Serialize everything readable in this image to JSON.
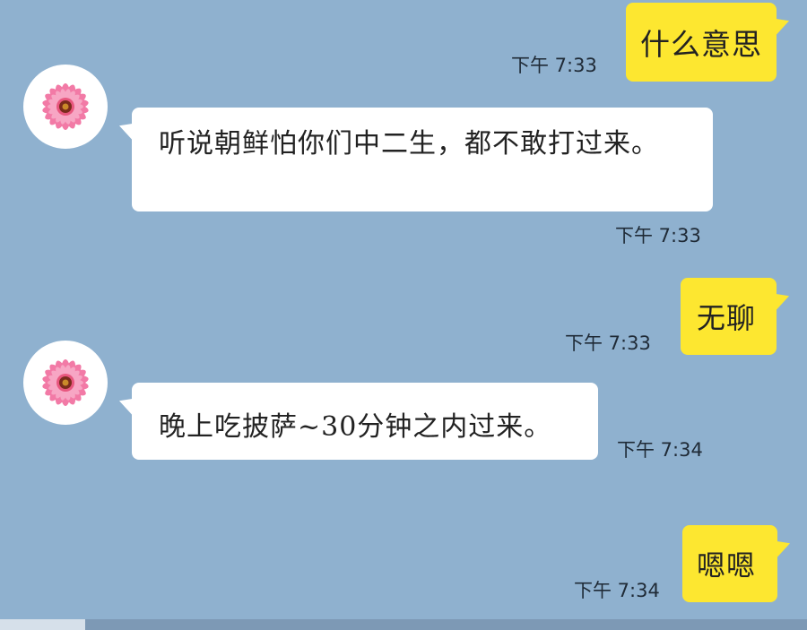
{
  "messages": [
    {
      "side": "outgoing",
      "text": "什么意思",
      "time": "下午 7:33"
    },
    {
      "side": "incoming",
      "text": "听说朝鲜怕你们中二生，都不敢打过来。",
      "time": "下午 7:33"
    },
    {
      "side": "outgoing",
      "text": "无聊",
      "time": "下午 7:33"
    },
    {
      "side": "incoming",
      "text": "晚上吃披萨~30分钟之内过来。",
      "time": "下午 7:34"
    },
    {
      "side": "outgoing",
      "text": "嗯嗯",
      "time": "下午 7:34"
    }
  ],
  "colors": {
    "background": "#8fb1cf",
    "outgoing_bubble": "#fde730",
    "incoming_bubble": "#ffffff"
  },
  "avatar_icon": "pink-gerbera-daisy-icon"
}
